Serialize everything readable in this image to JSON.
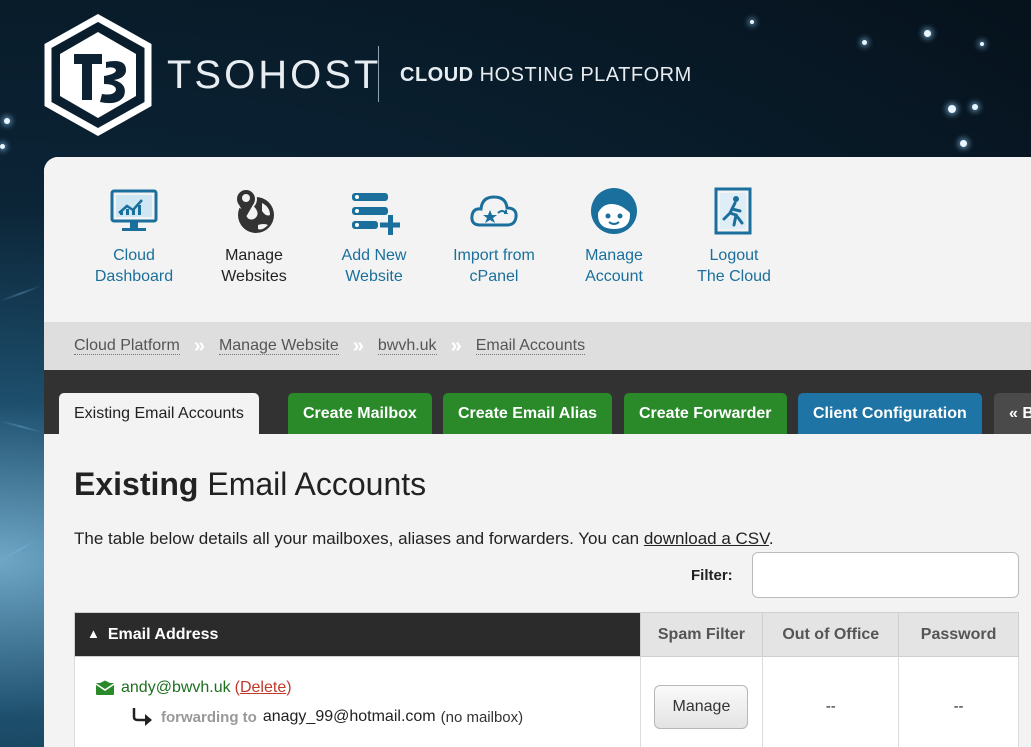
{
  "header": {
    "brand": "TSOHOST",
    "tagline_bold": "CLOUD",
    "tagline_rest": " HOSTING PLATFORM"
  },
  "nav": [
    {
      "line1": "Cloud",
      "line2": "Dashboard",
      "icon": "dashboard-monitor-icon"
    },
    {
      "line1": "Manage",
      "line2": "Websites",
      "icon": "globe-pin-icon"
    },
    {
      "line1": "Add New",
      "line2": "Website",
      "icon": "list-add-icon"
    },
    {
      "line1": "Import from",
      "line2": "cPanel",
      "icon": "cloud-import-icon"
    },
    {
      "line1": "Manage",
      "line2": "Account",
      "icon": "user-face-icon"
    },
    {
      "line1": "Logout",
      "line2": "The Cloud",
      "icon": "exit-door-icon"
    }
  ],
  "breadcrumb": [
    "Cloud Platform",
    "Manage Website",
    "bwvh.uk",
    "Email Accounts"
  ],
  "breadcrumb_separator": "»",
  "tabs": [
    {
      "label": "Existing Email Accounts",
      "style": "active"
    },
    {
      "label": "Create Mailbox",
      "style": "green"
    },
    {
      "label": "Create Email Alias",
      "style": "green"
    },
    {
      "label": "Create Forwarder",
      "style": "green"
    },
    {
      "label": "Client Configuration",
      "style": "blue"
    },
    {
      "label": "« B",
      "style": "gray"
    }
  ],
  "page": {
    "title_bold": "Existing",
    "title_rest": " Email Accounts",
    "intro_text": "The table below details all your mailboxes, aliases and forwarders. You can ",
    "intro_link": "download a CSV",
    "intro_end": ".",
    "filter_label": "Filter:",
    "filter_value": ""
  },
  "table": {
    "columns": [
      "Email Address",
      "Spam Filter",
      "Out of Office",
      "Password"
    ],
    "sort_indicator": "^",
    "rows": [
      {
        "email": "andy@bwvh.uk",
        "delete_open": "(",
        "delete_label": "Delete",
        "delete_close": ")",
        "forward_label": "forwarding to",
        "forward_target": "anagy_99@hotmail.com",
        "forward_note": "(no mailbox)",
        "spam_button": "Manage",
        "out_of_office": "--",
        "password": "--"
      }
    ]
  },
  "colors": {
    "link_blue": "#1a6f9c",
    "tab_green": "#2a8a2a",
    "tab_blue": "#1f74a6",
    "email_green": "#1d6f20",
    "delete_red": "#c0392b"
  }
}
